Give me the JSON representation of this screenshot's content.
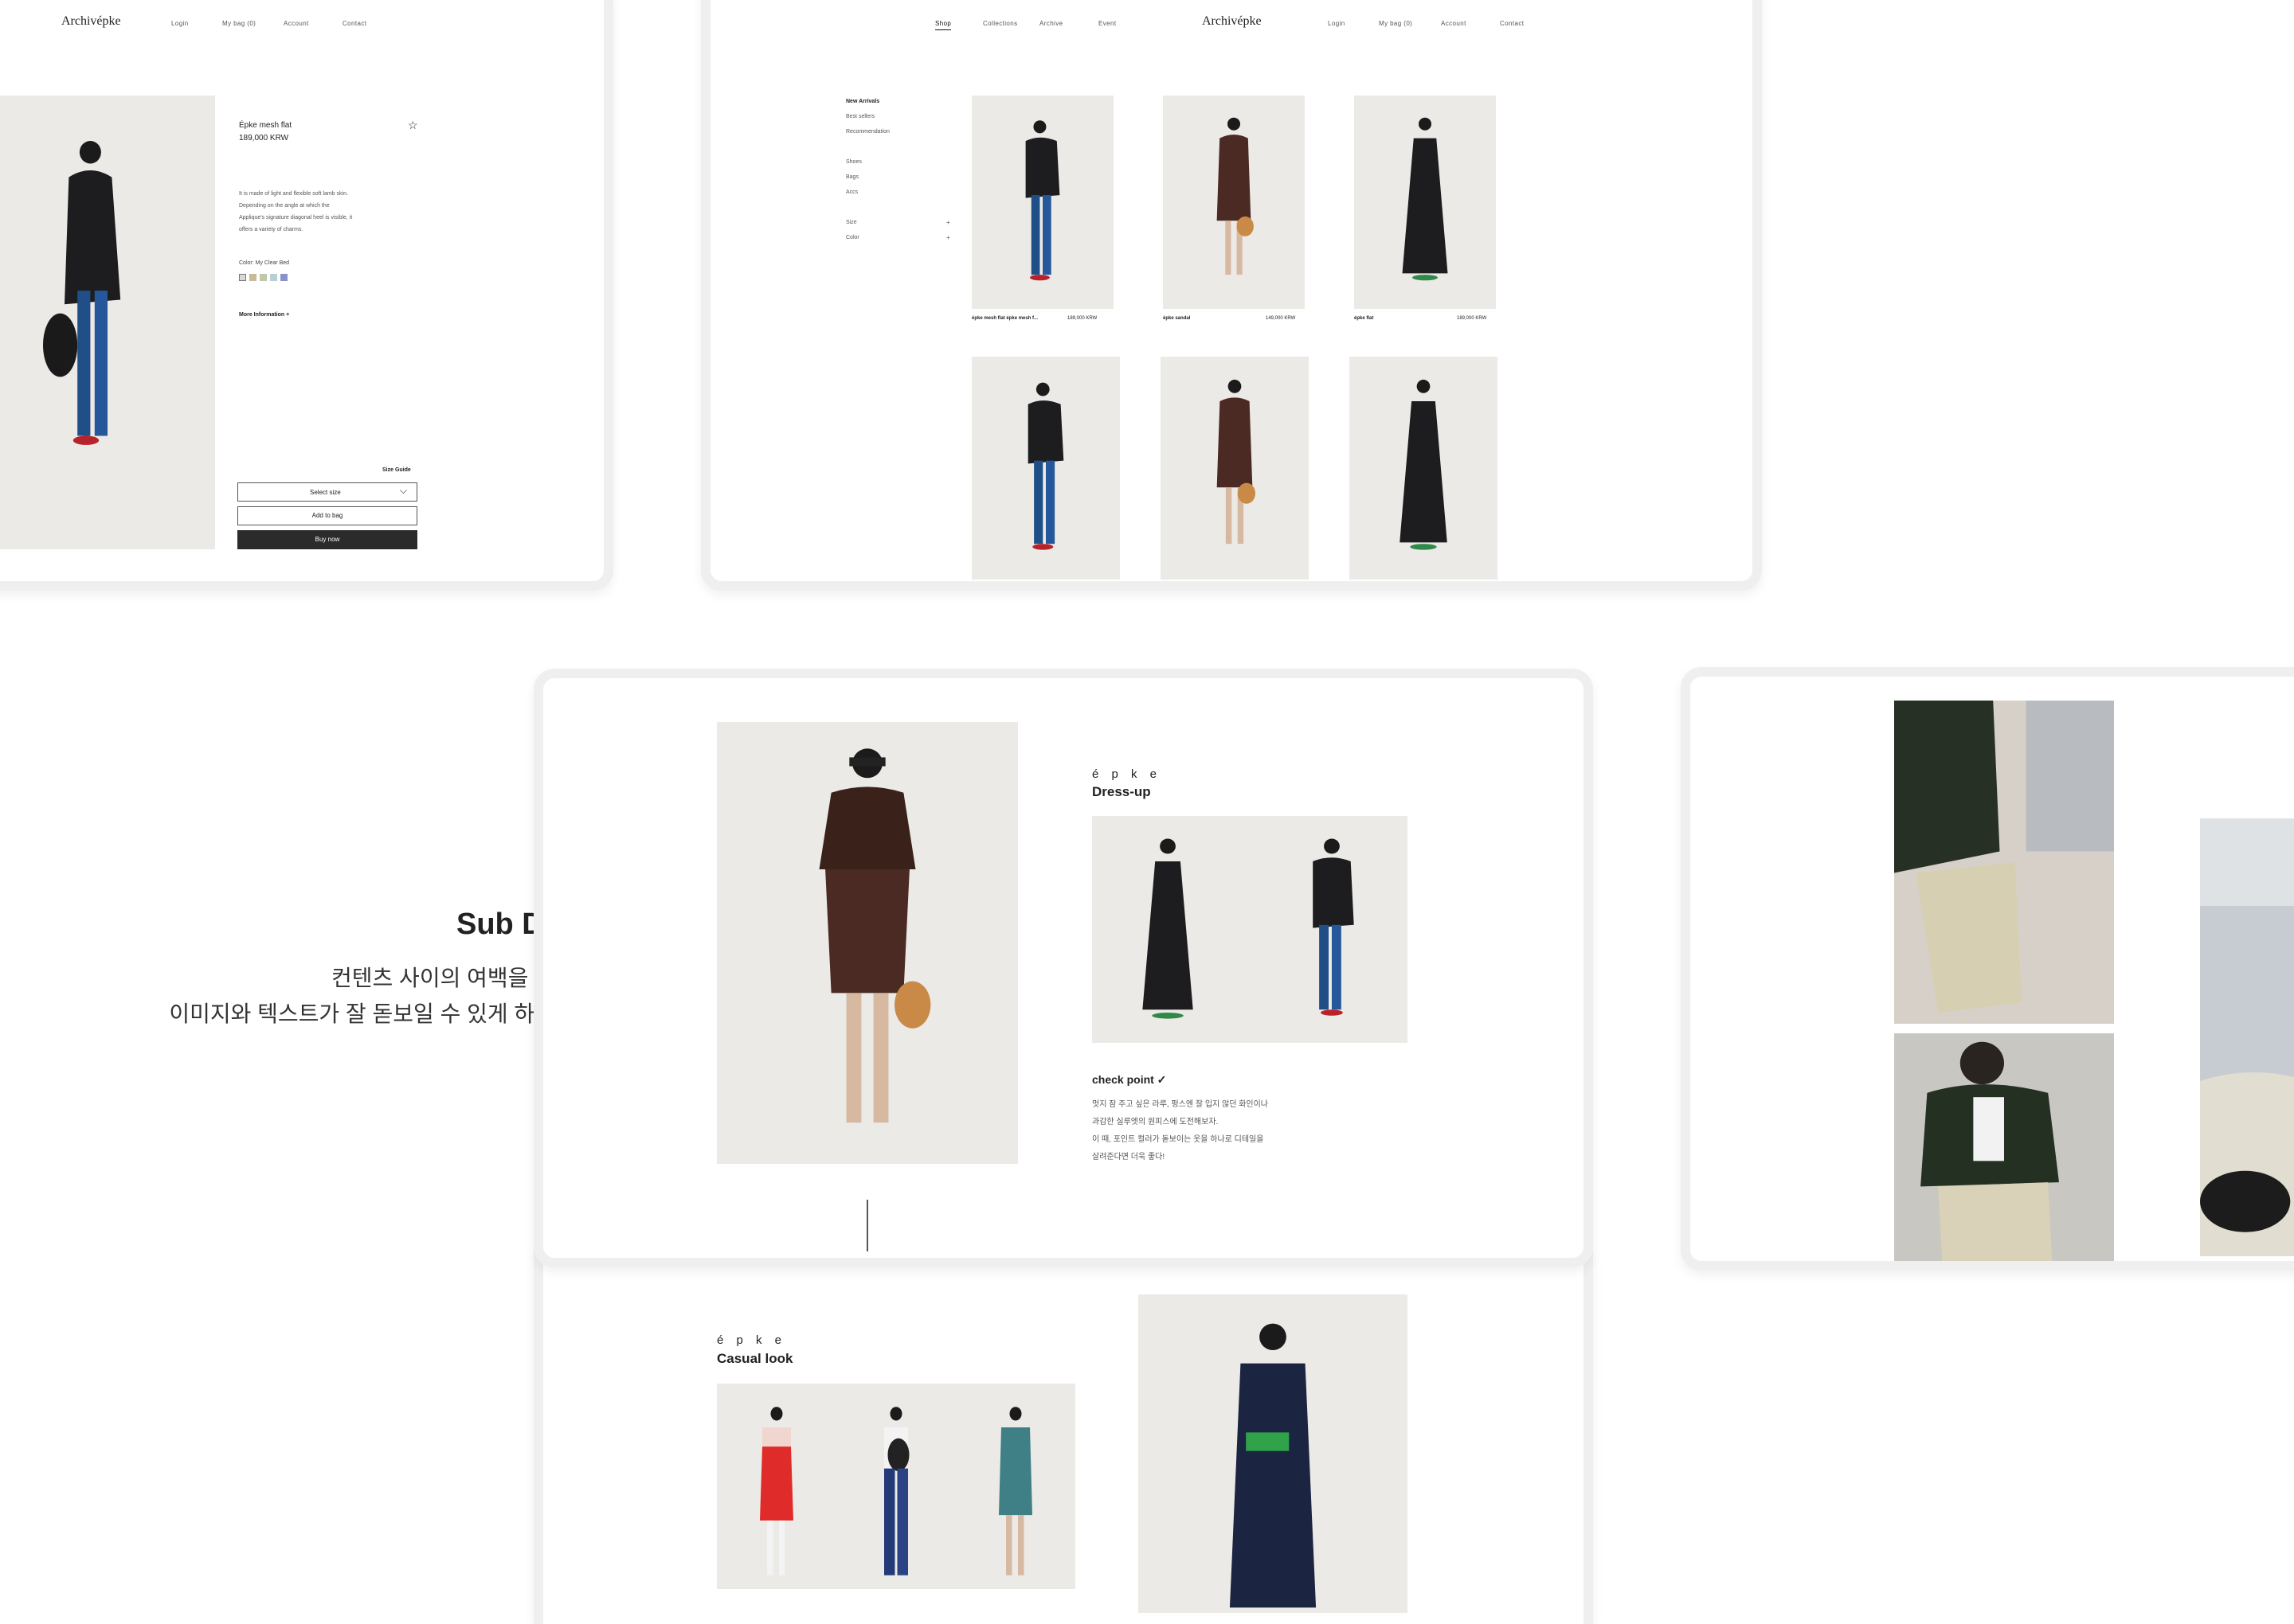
{
  "brand": {
    "logo": "Archivépke"
  },
  "pdp": {
    "nav": [
      "Login",
      "My bag (0)",
      "Account",
      "Contact"
    ],
    "product_name": "Épke mesh flat",
    "price": "189,000 KRW",
    "desc": [
      "It is made of light and flexible soft lamb skin.",
      "Depending on the angle at which the",
      "Applique's signature diagonal heel is visible, it",
      "offers a variety of charms."
    ],
    "color_label": "Color: My Clear Bed",
    "swatches": [
      "#d8d8d8",
      "#c9b89c",
      "#bfc8a8",
      "#b9cfd6",
      "#8a93c9"
    ],
    "more_info": "More Information +",
    "size_guide": "Size Guide",
    "select_size": "Select size",
    "add_to_bag": "Add to bag",
    "buy_now": "Buy now"
  },
  "shop": {
    "nav_left": [
      "Shop",
      "Collections",
      "Archive",
      "Event"
    ],
    "nav_right": [
      "Login",
      "My bag (0)",
      "Account",
      "Contact"
    ],
    "sidebar_group1": [
      "New Arrivals",
      "Best sellers",
      "Recommendation"
    ],
    "sidebar_group2": [
      "Shoes",
      "Bags",
      "Accs"
    ],
    "filters": [
      {
        "label": "Size",
        "toggle": "+"
      },
      {
        "label": "Color",
        "toggle": "+"
      }
    ],
    "products": [
      {
        "name": "épke mesh flat épke mesh f...",
        "price": "189,000 KRW"
      },
      {
        "name": "épke sandal",
        "price": "149,000 KRW"
      },
      {
        "name": "épke flat",
        "price": "189,000 KRW"
      }
    ]
  },
  "sub": {
    "title": "Sub Design",
    "line1": "컨텐츠 사이의 여백을 넓게 주어",
    "line2": "이미지와 텍스트가 잘 돋보일 수 있게 하였습니다."
  },
  "dress": {
    "brand_spaced": "é p k e",
    "heading": "Dress-up",
    "check_title": "check point ✓",
    "check_body": [
      "멋지 잠 주고 싶은 라루, 펑스엔 잘 입지 않던 화인이나",
      "과감한 실루엣의 원피스에 도전해보자.",
      "이 때, 포인트 컬러가 돋보이는 옷을 하나로 디테일을",
      "살려준다면 더욱 좋다!"
    ]
  },
  "casual": {
    "brand_spaced": "é p k e",
    "heading": "Casual look"
  },
  "colors": {
    "frame": "#efefef",
    "photo_bg": "#eceae6",
    "buy_btn": "#2b2b2b",
    "dark_garment": "#1d1d1f",
    "denim": "#1f4f86"
  }
}
